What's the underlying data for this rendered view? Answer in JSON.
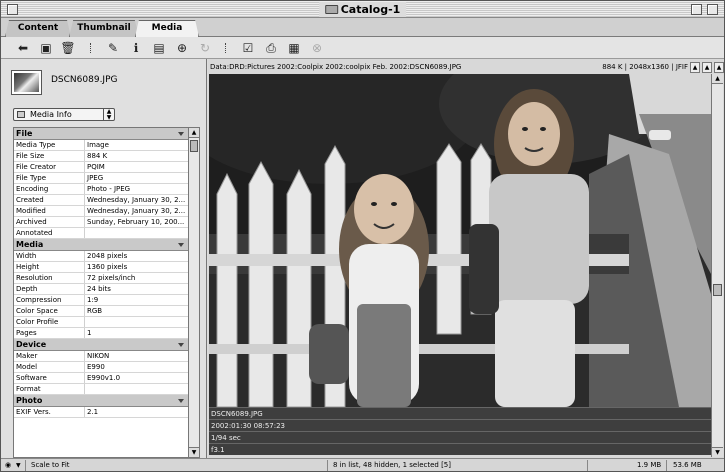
{
  "window": {
    "title": "Catalog-1"
  },
  "tabs": [
    {
      "label": "Content",
      "active": false
    },
    {
      "label": "Thumbnail",
      "active": false
    },
    {
      "label": "Media",
      "active": true
    }
  ],
  "toolbar": {
    "icons": [
      "back-icon",
      "open-icon",
      "trash-icon",
      "tag-icon",
      "info-icon",
      "slideshow-icon",
      "zoom-icon",
      "rotate-icon",
      "checkbox-icon",
      "print-icon",
      "export-icon",
      "stop-icon"
    ]
  },
  "left": {
    "filename": "DSCN6089.JPG",
    "view_select": "Media Info",
    "groups": [
      {
        "title": "File",
        "rows": [
          {
            "k": "Media Type",
            "v": "Image"
          },
          {
            "k": "File Size",
            "v": "884 K"
          },
          {
            "k": "File Creator",
            "v": "PQIM"
          },
          {
            "k": "File Type",
            "v": "JPEG"
          },
          {
            "k": "Encoding",
            "v": "Photo - JPEG"
          },
          {
            "k": "Created",
            "v": "Wednesday, January 30, 2..."
          },
          {
            "k": "Modified",
            "v": "Wednesday, January 30, 2..."
          },
          {
            "k": "Archived",
            "v": "Sunday, February 10, 200..."
          },
          {
            "k": "Annotated",
            "v": ""
          }
        ]
      },
      {
        "title": "Media",
        "rows": [
          {
            "k": "Width",
            "v": "2048 pixels"
          },
          {
            "k": "Height",
            "v": "1360 pixels"
          },
          {
            "k": "Resolution",
            "v": "72 pixels/inch"
          },
          {
            "k": "Depth",
            "v": "24 bits"
          },
          {
            "k": "Compression",
            "v": "1:9"
          },
          {
            "k": "Color Space",
            "v": "RGB"
          },
          {
            "k": "Color Profile",
            "v": ""
          },
          {
            "k": "Pages",
            "v": "1"
          }
        ]
      },
      {
        "title": "Device",
        "rows": [
          {
            "k": "Maker",
            "v": "NIKON"
          },
          {
            "k": "Model",
            "v": "E990"
          },
          {
            "k": "Software",
            "v": "E990v1.0"
          },
          {
            "k": "Format",
            "v": ""
          }
        ]
      },
      {
        "title": "Photo",
        "rows": [
          {
            "k": "EXIF Vers.",
            "v": "2.1"
          }
        ]
      }
    ]
  },
  "right": {
    "path": "Data:DRD:Pictures 2002:Coolpix 2002:coolpix Feb. 2002:DSCN6089.JPG",
    "meta": "884 K  |  2048x1360  |  JFIF",
    "captions": [
      "DSCN6089.JPG",
      "2002:01:30 08:57:23",
      "1/94 sec",
      "f3.1"
    ]
  },
  "status": {
    "zoom": "Scale to Fit",
    "list_info": "8 in list, 48 hidden, 1 selected [5]",
    "size1": "1.9 MB",
    "size2": "53.6 MB"
  }
}
